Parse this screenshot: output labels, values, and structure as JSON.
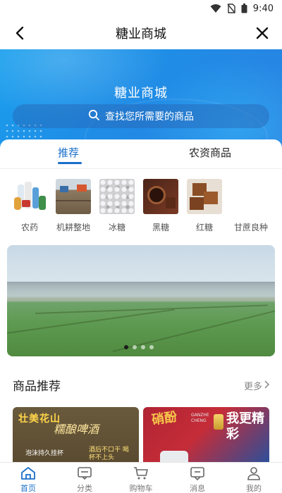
{
  "status_bar": {
    "time": "9:40"
  },
  "header": {
    "title": "糖业商城"
  },
  "hero": {
    "title": "糖业商城",
    "search_placeholder": "查找您所需要的商品"
  },
  "tabs": [
    {
      "label": "推荐",
      "active": true
    },
    {
      "label": "农资商品",
      "active": false
    }
  ],
  "categories": [
    {
      "label": "农药",
      "icon": "pesticide-bottles"
    },
    {
      "label": "机耕整地",
      "icon": "tractor-field"
    },
    {
      "label": "冰糖",
      "icon": "rock-sugar"
    },
    {
      "label": "黑糖",
      "icon": "black-sugar"
    },
    {
      "label": "红糖",
      "icon": "brown-sugar-cubes"
    },
    {
      "label": "甘蔗良种",
      "icon": "sugarcane"
    }
  ],
  "banner": {
    "pages": 4,
    "active_page": 1
  },
  "recommend": {
    "title": "商品推荐",
    "more_label": "更多"
  },
  "products": [
    {
      "headline": "壮美花山",
      "slogan": "糯酿啤酒",
      "tag": "泡沫持久挂杯",
      "note": "酒后不口干 喝杯不上头"
    },
    {
      "headline": "硝酚",
      "subtext": "GANZHE CHENG",
      "headline2": "我更精彩"
    }
  ],
  "bottom_nav": [
    {
      "label": "首页",
      "icon": "home-icon",
      "active": true
    },
    {
      "label": "分类",
      "icon": "category-icon",
      "active": false
    },
    {
      "label": "购物车",
      "icon": "cart-icon",
      "active": false
    },
    {
      "label": "消息",
      "icon": "message-icon",
      "active": false
    },
    {
      "label": "我的",
      "icon": "profile-icon",
      "active": false
    }
  ],
  "colors": {
    "primary": "#1a6fc9",
    "hero_start": "#1aa0ee",
    "hero_end": "#2c7fe0"
  }
}
